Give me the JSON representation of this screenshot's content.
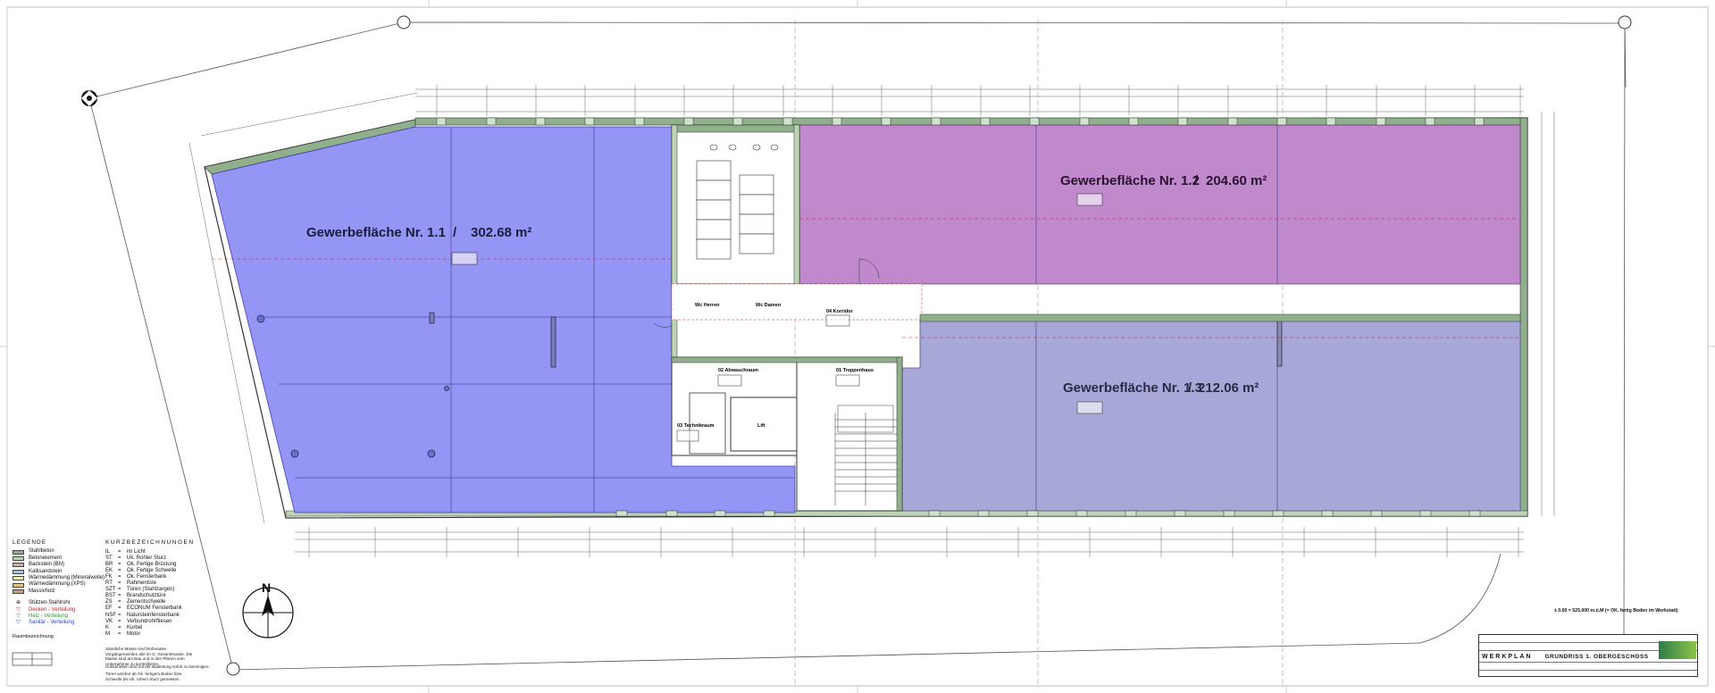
{
  "title_block": {
    "plan_type": "WERKPLAN",
    "drawing_title": "GRUNDRISS 1. OBERGESCHOSS",
    "level_note": "± 0.00 = 525.000 m.ü.M  (= OK. fertig Boden im Werkstatt)"
  },
  "units": [
    {
      "name": "Gewerbefläche Nr. 1.1",
      "area": "302.68 m²",
      "color": "#8f8ff5"
    },
    {
      "name": "Gewerbefläche Nr. 1.2",
      "area": "204.60 m²",
      "color": "#c089cc"
    },
    {
      "name": "Gewerbefläche Nr. 1.3",
      "area": "212.06 m²",
      "color": "#a8a8d8"
    }
  ],
  "rooms": [
    {
      "label": "Wc Herren"
    },
    {
      "label": "Wc Damen"
    },
    {
      "label": "04 Korridor"
    },
    {
      "label": "02 Abwaschraum"
    },
    {
      "label": "01 Treppenhaus"
    },
    {
      "label": "03 Technikraum"
    },
    {
      "label": "Lift"
    }
  ],
  "north_label": "N",
  "legend": {
    "heading": "LEGENDE",
    "items": [
      {
        "label": "Stahlbeton",
        "color": "#8fb08a"
      },
      {
        "label": "Betonelement",
        "color": "#bcd6b4"
      },
      {
        "label": "Backstein (BN)",
        "color": "#e0a3a3"
      },
      {
        "label": "Kalksandstein",
        "color": "#9fc3e6"
      },
      {
        "label": "Wärmedämmung (Mineralwolle)",
        "color": "#f3efb8"
      },
      {
        "label": "Wärmedämmung (XPS)",
        "color": "#e9c28c"
      },
      {
        "label": "Massivholz",
        "color": "#c2a27d"
      }
    ],
    "markers": [
      {
        "symbol": "⊕",
        "label": "Stützen-Stahlrohr",
        "color": "#222222"
      },
      {
        "symbol": "▽",
        "label": "Decken - Verteilung",
        "color": "#d02020"
      },
      {
        "symbol": "▽",
        "label": "Heiz - Verteilung",
        "color": "#2a9a2a"
      },
      {
        "symbol": "▽",
        "label": "Sanitär - Verteilung",
        "color": "#2040d0"
      }
    ]
  },
  "abbreviations": {
    "heading": "KURZBEZEICHNUNGEN",
    "items": [
      {
        "k": "IL",
        "v": "im Licht"
      },
      {
        "k": "ST",
        "v": "Uk. Rohler Sturz"
      },
      {
        "k": "BR",
        "v": "Ok. Fertige Brüstung"
      },
      {
        "k": "EK",
        "v": "Ok. Fertige Schwelle"
      },
      {
        "k": "FK",
        "v": "Ok. Fensterbank"
      },
      {
        "k": "RT",
        "v": "Rahmentüre"
      },
      {
        "k": "SZT",
        "v": "Türen (Stahlzargen)"
      },
      {
        "k": "BST",
        "v": "Brandschutztüre"
      },
      {
        "k": "ZS",
        "v": "Zementschwelle"
      },
      {
        "k": "EF",
        "v": "ECONUM Fensterbank"
      },
      {
        "k": "NSF",
        "v": "Natursteinfensterbank"
      },
      {
        "k": "VK",
        "v": "Verbundrohrfliesen"
      },
      {
        "k": "K",
        "v": "Kurbel"
      },
      {
        "k": "M",
        "v": "Motor"
      }
    ]
  },
  "notes": {
    "room_legend_heading": "Raumbezeichnung",
    "dimension_note": "Sämtliche Masse sind Rohmasse. Vorgängerwerden alle im G. Gesamtmasse. Die Masse sind am Bau und in den Plänen vom Unternehmer zu kontrollieren.",
    "discrepancy_note": "Unklarheiten sind mit der Bauleitung sofort zu bereinigen.",
    "door_note": "Türen werden ab Ok. fertigem Boden bzw. Schwelle bis Uk. rohem Sturz gemessen."
  }
}
